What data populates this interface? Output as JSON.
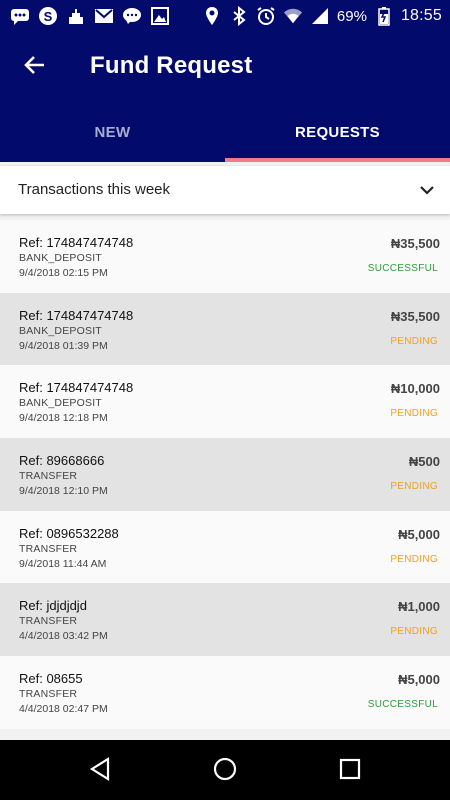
{
  "status_bar": {
    "battery": "69%",
    "time": "18:55",
    "left_icons": [
      "messages-icon",
      "skype-icon",
      "cake-icon",
      "gmail-icon",
      "chat-icon",
      "image-icon"
    ],
    "right_icons": [
      "location-icon",
      "bluetooth-icon",
      "alarm-icon",
      "wifi-icon",
      "signal-icon",
      "battery-icon"
    ]
  },
  "app_bar": {
    "title": "Fund Request",
    "back_icon": "arrow-back-icon"
  },
  "tabs": [
    {
      "label": "NEW",
      "active": false
    },
    {
      "label": "REQUESTS",
      "active": true
    }
  ],
  "filter": {
    "selected": "Transactions this week",
    "icon": "chevron-down-icon"
  },
  "transactions": [
    {
      "ref": "Ref: 174847474748",
      "type": "BANK_DEPOSIT",
      "date": "9/4/2018 02:15 PM",
      "amount": "₦35,500",
      "status": "SUCCESSFUL"
    },
    {
      "ref": "Ref: 174847474748",
      "type": "BANK_DEPOSIT",
      "date": "9/4/2018 01:39 PM",
      "amount": "₦35,500",
      "status": "PENDING"
    },
    {
      "ref": "Ref: 174847474748",
      "type": "BANK_DEPOSIT",
      "date": "9/4/2018 12:18 PM",
      "amount": "₦10,000",
      "status": "PENDING"
    },
    {
      "ref": "Ref: 89668666",
      "type": "TRANSFER",
      "date": "9/4/2018 12:10 PM",
      "amount": "₦500",
      "status": "PENDING"
    },
    {
      "ref": "Ref: 0896532288",
      "type": "TRANSFER",
      "date": "9/4/2018 11:44 AM",
      "amount": "₦5,000",
      "status": "PENDING"
    },
    {
      "ref": "Ref: jdjdjdjd",
      "type": "TRANSFER",
      "date": "4/4/2018 03:42 PM",
      "amount": "₦1,000",
      "status": "PENDING"
    },
    {
      "ref": "Ref: 08655",
      "type": "TRANSFER",
      "date": "4/4/2018 02:47 PM",
      "amount": "₦5,000",
      "status": "SUCCESSFUL"
    }
  ],
  "colors": {
    "primary": "#020a6b",
    "tab_indicator": "#f07a8c",
    "successful": "#2e9c3a",
    "pending": "#f0a020"
  },
  "nav_bar": {
    "icons": [
      "back-triangle-icon",
      "home-circle-icon",
      "recents-square-icon"
    ]
  }
}
